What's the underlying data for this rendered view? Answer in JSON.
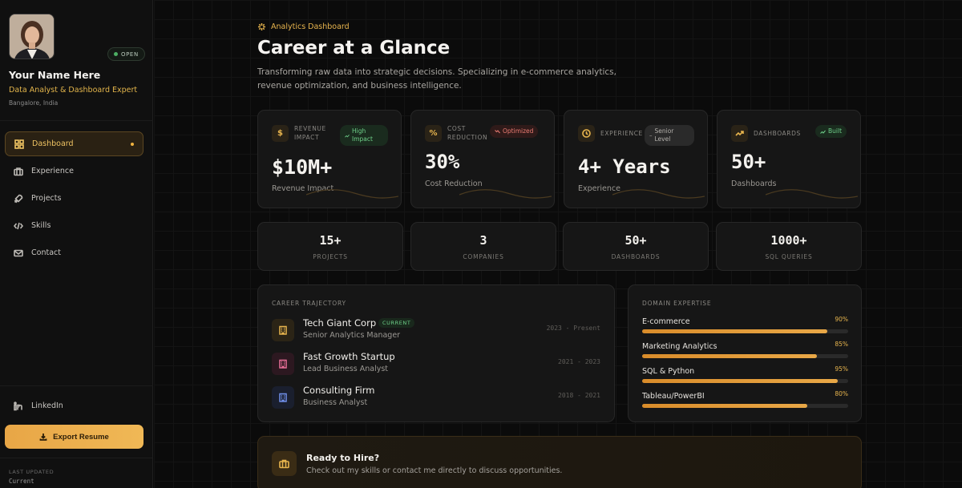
{
  "sidebar": {
    "profile": {
      "status": "OPEN",
      "name": "Your Name Here",
      "role": "Data Analyst & Dashboard Expert",
      "location": "Bangalore, India"
    },
    "nav": [
      {
        "label": "Dashboard",
        "icon": "grid-icon",
        "active": true
      },
      {
        "label": "Experience",
        "icon": "briefcase-icon",
        "active": false
      },
      {
        "label": "Projects",
        "icon": "rocket-icon",
        "active": false
      },
      {
        "label": "Skills",
        "icon": "code-icon",
        "active": false
      },
      {
        "label": "Contact",
        "icon": "mail-icon",
        "active": false
      }
    ],
    "linkedin": "LinkedIn",
    "export_label": "Export Resume",
    "last_updated_label": "LAST UPDATED",
    "last_updated_value": "Current"
  },
  "header": {
    "eyebrow": "Analytics Dashboard",
    "title": "Career at a Glance",
    "subtitle": "Transforming raw data into strategic decisions. Specializing in e-commerce analytics, revenue optimization, and business intelligence."
  },
  "stats": [
    {
      "label": "REVENUE IMPACT",
      "badge": "High Impact",
      "badge_type": "green",
      "value": "$10M+",
      "caption": "Revenue Impact",
      "icon": "dollar-icon"
    },
    {
      "label": "COST REDUCTION",
      "badge": "Optimized",
      "badge_type": "red",
      "value": "30%",
      "caption": "Cost Reduction",
      "icon": "percent-icon"
    },
    {
      "label": "EXPERIENCE",
      "badge": "Senior Level",
      "badge_type": "gray",
      "value": "4+ Years",
      "caption": "Experience",
      "icon": "clock-icon"
    },
    {
      "label": "DASHBOARDS",
      "badge": "Built",
      "badge_type": "green",
      "value": "50+",
      "caption": "Dashboards",
      "icon": "trend-icon"
    }
  ],
  "mini_stats": [
    {
      "value": "15+",
      "label": "PROJECTS"
    },
    {
      "value": "3",
      "label": "COMPANIES"
    },
    {
      "value": "50+",
      "label": "DASHBOARDS"
    },
    {
      "value": "1000+",
      "label": "SQL QUERIES"
    }
  ],
  "trajectory": {
    "title": "CAREER TRAJECTORY",
    "current_badge": "CURRENT",
    "items": [
      {
        "company": "Tech Giant Corp",
        "title": "Senior Analytics Manager",
        "years": "2023 - Present",
        "color": "#e8b54e",
        "bg": "#2b2416"
      },
      {
        "company": "Fast Growth Startup",
        "title": "Lead Business Analyst",
        "years": "2021 - 2023",
        "color": "#e86f97",
        "bg": "#2c1820"
      },
      {
        "company": "Consulting Firm",
        "title": "Business Analyst",
        "years": "2018 - 2021",
        "color": "#6f8fe8",
        "bg": "#1a1f2e"
      }
    ]
  },
  "expertise": {
    "title": "DOMAIN EXPERTISE",
    "items": [
      {
        "name": "E-commerce",
        "pct_label": "90%",
        "value": 0.9
      },
      {
        "name": "Marketing Analytics",
        "pct_label": "85%",
        "value": 0.85
      },
      {
        "name": "SQL & Python",
        "pct_label": "95%",
        "value": 0.95
      },
      {
        "name": "Tableau/PowerBI",
        "pct_label": "80%",
        "value": 0.8
      }
    ]
  },
  "hire": {
    "title": "Ready to Hire?",
    "text": "Check out my skills or contact me directly to discuss opportunities."
  },
  "colors": {
    "accent": "#e8b54e",
    "success": "#6fd08a",
    "danger": "#ec7c73"
  }
}
